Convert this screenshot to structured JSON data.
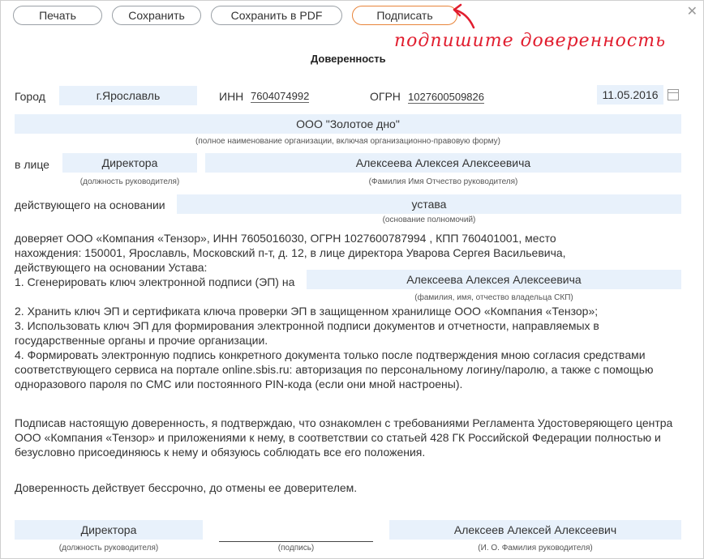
{
  "toolbar": {
    "print": "Печать",
    "save": "Сохранить",
    "save_pdf": "Сохранить в PDF",
    "sign": "Подписать",
    "annotation": "подпишите доверенность",
    "colors": {
      "accent": "#e8843a",
      "annotation": "#e11d2e"
    }
  },
  "doc": {
    "title": "Доверенность",
    "city_label": "Город",
    "city": "г.Ярославль",
    "inn_label": "ИНН",
    "inn": "7604074992",
    "ogrn_label": "ОГРН",
    "ogrn": "1027600509826",
    "date": "11.05.2016",
    "org_name": "ООО \"Золотое дно\"",
    "org_caption": "(полное наименование организации, включая организационно-правовую форму)",
    "in_person_label": "в лице",
    "position": "Директора",
    "position_caption": "(должность руководителя)",
    "head_name": "Алексеева Алексея Алексеевича",
    "head_caption": "(Фамилия Имя Отчество руководителя)",
    "basis_label": "действующего на основании",
    "basis": "устава",
    "basis_caption": "(основание  полномочий)",
    "para1": "доверяет ООО «Компания «Тензор», ИНН 7605016030, ОГРН 1027600787994 , КПП 760401001, место\nнахождения: 150001, Ярославль, Московский п-т, д. 12, в лице директора Уварова Сергея Васильевича,\nдействующего на основании Устава:",
    "item1_label": "1. Сгенерировать ключ электронной подписи (ЭП) на",
    "key_owner": "Алексеева Алексея Алексеевича",
    "key_owner_caption": "(фамилия, имя, отчество владельца СКП)",
    "para2": "2. Хранить ключ ЭП и сертификата ключа проверки ЭП в защищенном хранилище ООО «Компания «Тензор»;\n3. Использовать ключ ЭП для формирования электронной подписи документов и отчетности, направляемых в\nгосударственные органы и прочие организации.\n4. Формировать электронную подпись конкретного документа только после подтверждения мною согласия средствами\nсоответствующего сервиса на портале online.sbis.ru: авторизация по персональному логину/паролю, а также с помощью\nодноразового пароля по СМС или постоянного PIN-кода (если они мной настроены).",
    "para3": "Подписав настоящую доверенность, я подтверждаю, что ознакомлен с требованиями Регламента Удостоверяющего центра\nООО «Компания «Тензор» и приложениями к нему, в соответствии со статьей 428 ГК Российской Федерации полностью и\nбезусловно присоединяюсь к нему и обязуюсь соблюдать все его положения.",
    "para4": "Доверенность действует бессрочно, до отмены ее доверителем.",
    "sign_position": "Директора",
    "sign_position_caption": "(должность руководителя)",
    "sign_caption": "(подпись)",
    "sign_name": "Алексеев Алексей Алексеевич",
    "sign_name_caption": "(И. О. Фамилия руководителя)"
  }
}
